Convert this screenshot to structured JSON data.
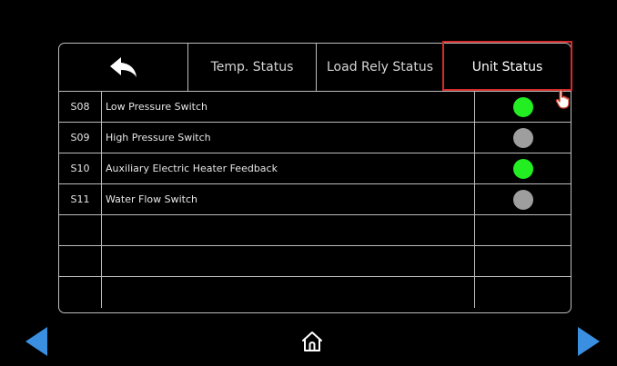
{
  "tabs": {
    "back_icon": "back-arrow-icon",
    "temp_status": "Temp. Status",
    "load_rely_status": "Load Rely Status",
    "unit_status": "Unit Status",
    "active": "Unit Status"
  },
  "rows": [
    {
      "code": "S08",
      "name": "Low Pressure Switch",
      "status": "on"
    },
    {
      "code": "S09",
      "name": "High Pressure Switch",
      "status": "off"
    },
    {
      "code": "S10",
      "name": "Auxiliary Electric Heater Feedback",
      "status": "on"
    },
    {
      "code": "S11",
      "name": "Water Flow Switch",
      "status": "off"
    },
    {
      "code": "",
      "name": "",
      "status": ""
    },
    {
      "code": "",
      "name": "",
      "status": ""
    },
    {
      "code": "",
      "name": "",
      "status": ""
    }
  ],
  "colors": {
    "background": "#000000",
    "grid_line": "#bdbdbd",
    "status_on": "#22ee22",
    "status_off": "#9e9e9e",
    "highlight": "#d42a2a",
    "nav_arrow": "#3b8fe0"
  },
  "bottom_nav": {
    "prev_icon": "left-arrow-icon",
    "home_icon": "home-icon",
    "next_icon": "right-arrow-icon"
  }
}
